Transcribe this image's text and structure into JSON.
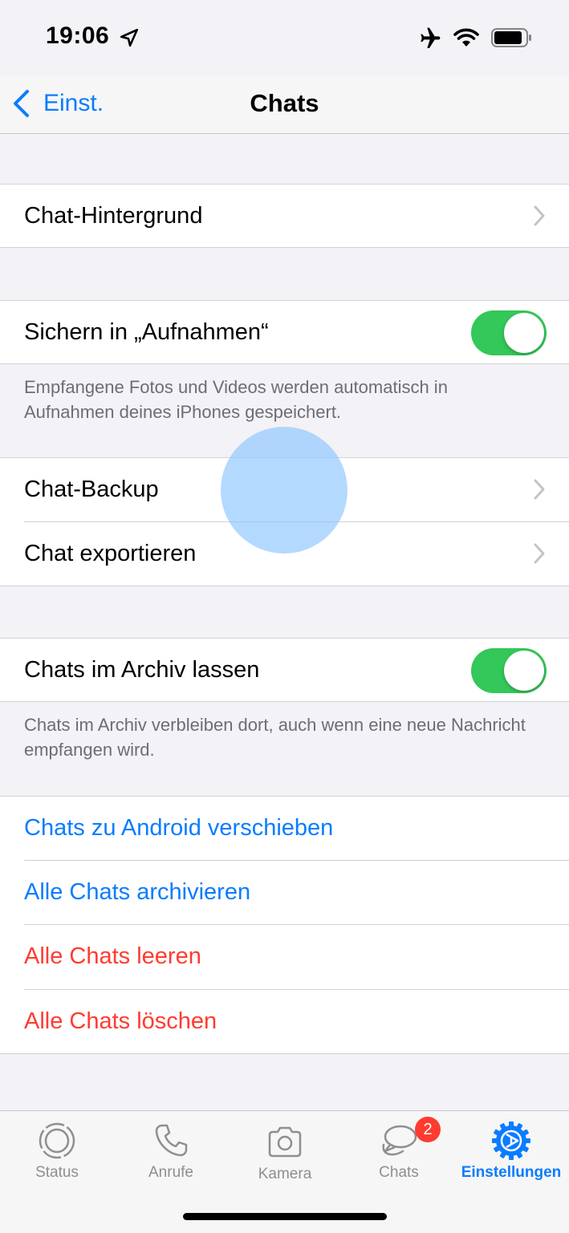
{
  "status_bar": {
    "time": "19:06"
  },
  "nav": {
    "back_label": "Einst.",
    "title": "Chats"
  },
  "settings": {
    "wallpaper": "Chat-Hintergrund",
    "save_to_photos": {
      "label": "Sichern in „Aufnahmen“",
      "enabled": true
    },
    "save_note": "Empfangene Fotos und Videos werden automatisch in Aufnahmen deines iPhones gespeichert.",
    "backup": "Chat-Backup",
    "export": "Chat exportieren",
    "keep_archived": {
      "label": "Chats im Archiv lassen",
      "enabled": true
    },
    "archive_note": "Chats im Archiv verbleiben dort, auch wenn eine neue Nachricht empfangen wird.",
    "move_android": "Chats zu Android verschieben",
    "archive_all": "Alle Chats archivieren",
    "clear_all": "Alle Chats leeren",
    "delete_all": "Alle Chats löschen"
  },
  "colors": {
    "accent": "#0a7cff",
    "destructive": "#ff3b30",
    "toggle_on": "#34c759"
  },
  "tabs": [
    {
      "label": "Status",
      "icon": "status-icon"
    },
    {
      "label": "Anrufe",
      "icon": "phone-icon"
    },
    {
      "label": "Kamera",
      "icon": "camera-icon"
    },
    {
      "label": "Chats",
      "icon": "chat-bubbles-icon",
      "badge": "2"
    },
    {
      "label": "Einstellungen",
      "icon": "settings-gear-icon",
      "active": true
    }
  ]
}
